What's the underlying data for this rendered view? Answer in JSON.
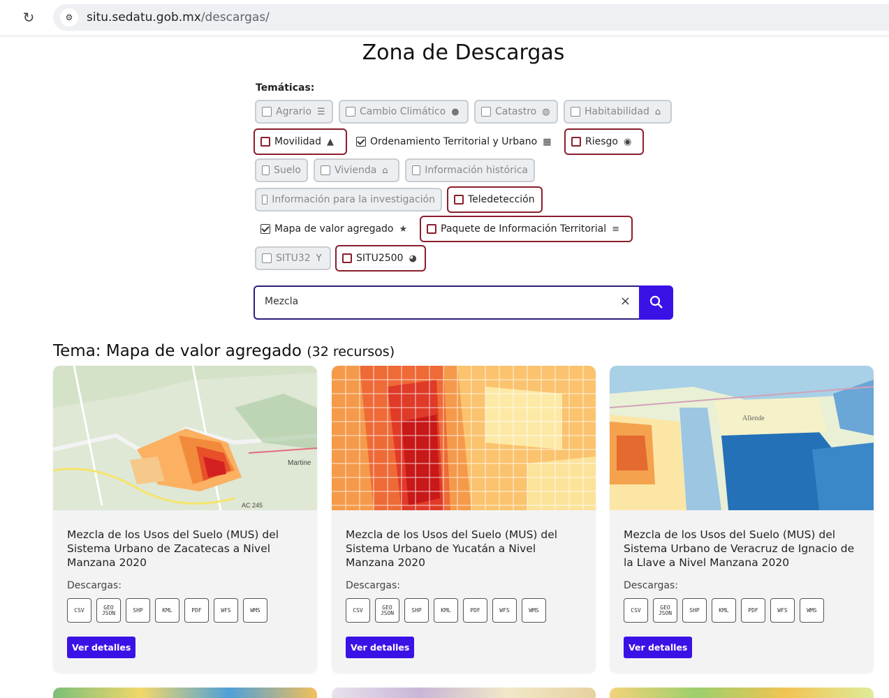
{
  "browser": {
    "url_host": "situ.sedatu.gob.mx",
    "url_path": "/descargas/"
  },
  "page": {
    "title": "Zona de Descargas",
    "tematicas_label": "Temáticas:"
  },
  "tematicas": [
    {
      "label": "Agrario",
      "state": "disabled",
      "icon": "bars-icon"
    },
    {
      "label": "Cambio Climático",
      "state": "disabled",
      "icon": "drop-icon"
    },
    {
      "label": "Catastro",
      "state": "disabled",
      "icon": "globe-icon"
    },
    {
      "label": "Habitabilidad",
      "state": "disabled",
      "icon": "home-icon"
    },
    {
      "label": "Movilidad",
      "state": "outlined",
      "icon": "road-icon"
    },
    {
      "label": "Ordenamiento Territorial y Urbano",
      "state": "checked",
      "icon": "building-icon"
    },
    {
      "label": "Riesgo",
      "state": "outlined",
      "icon": "fire-icon"
    },
    {
      "label": "Suelo",
      "state": "disabled",
      "icon": ""
    },
    {
      "label": "Vivienda",
      "state": "disabled",
      "icon": "home-icon"
    },
    {
      "label": "Información histórica",
      "state": "disabled",
      "icon": ""
    },
    {
      "label": "Información para la investigación",
      "state": "disabled",
      "icon": ""
    },
    {
      "label": "Teledetección",
      "state": "outlined",
      "icon": ""
    },
    {
      "label": "Mapa de valor agregado",
      "state": "checked",
      "icon": "star-icon"
    },
    {
      "label": "Paquete de Información Territorial",
      "state": "outlined",
      "icon": "database-icon"
    },
    {
      "label": "SITU32",
      "state": "disabled",
      "icon": "fork-icon"
    },
    {
      "label": "SITU2500",
      "state": "outlined",
      "icon": "pie-icon"
    }
  ],
  "search": {
    "value": "Mezcla",
    "clear_glyph": "×",
    "button_glyph": "⚲"
  },
  "section": {
    "title": "Tema: Mapa de valor agregado",
    "count": "(32 recursos)"
  },
  "cards": [
    {
      "title": "Mezcla de los Usos del Suelo (MUS) del Sistema Urbano de Zacatecas a Nivel Manzana 2020",
      "downloads_label": "Descargas:",
      "button": "Ver detalles"
    },
    {
      "title": "Mezcla de los Usos del Suelo (MUS) del Sistema Urbano de Yucatán a Nivel Manzana 2020",
      "downloads_label": "Descargas:",
      "button": "Ver detalles"
    },
    {
      "title": "Mezcla de los Usos del Suelo (MUS) del Sistema Urbano de Veracruz de Ignacio de la Llave a Nivel Manzana 2020",
      "downloads_label": "Descargas:",
      "button": "Ver detalles"
    }
  ],
  "download_formats": [
    "CSV",
    "GEO JSON",
    "SHP",
    "KML",
    "PDF",
    "WFS",
    "WMS"
  ],
  "colors": {
    "accent": "#3b12e6",
    "outline": "#8b1d2c",
    "search_border": "#2a1f7a"
  }
}
